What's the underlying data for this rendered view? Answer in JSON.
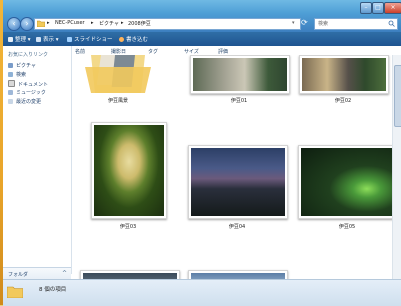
{
  "address": {
    "crumbs": [
      "NEC-PCuser",
      "ピクチャ",
      "2008伊豆"
    ],
    "search_placeholder": "検索"
  },
  "toolbar": {
    "items": [
      "整理",
      "表示",
      "スライドショー",
      "書き込む"
    ]
  },
  "leftpane": {
    "heading": "お気に入りリンク",
    "links": [
      "ピクチャ",
      "検索",
      "ドキュメント",
      "ミュージック",
      "最近の変更"
    ],
    "folders_label": "フォルダ"
  },
  "columns": [
    "名前",
    "撮影日",
    "タグ",
    "サイズ",
    "評価"
  ],
  "files": [
    {
      "name": "伊豆風景"
    },
    {
      "name": "伊豆01"
    },
    {
      "name": "伊豆02"
    },
    {
      "name": "伊豆03"
    },
    {
      "name": "伊豆04"
    },
    {
      "name": "伊豆05"
    }
  ],
  "status": {
    "text": "8 個の項目"
  },
  "colors": {
    "toolbar": "#1f5490",
    "address_bar": "#4f9fd6",
    "desktop": "#e9a52a"
  },
  "icons": [
    "back-arrow-icon",
    "forward-arrow-icon",
    "folder-icon",
    "refresh-icon",
    "search-icon",
    "minimize-icon",
    "maximize-icon",
    "close-icon"
  ]
}
